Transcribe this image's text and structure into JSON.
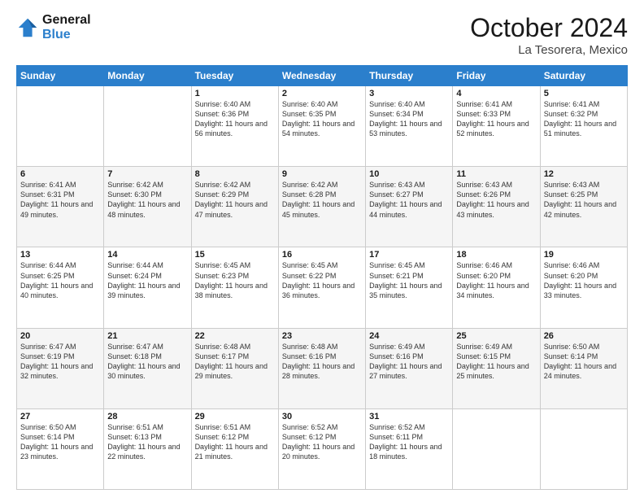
{
  "logo": {
    "line1": "General",
    "line2": "Blue"
  },
  "header": {
    "month": "October 2024",
    "location": "La Tesorera, Mexico"
  },
  "weekdays": [
    "Sunday",
    "Monday",
    "Tuesday",
    "Wednesday",
    "Thursday",
    "Friday",
    "Saturday"
  ],
  "weeks": [
    [
      {
        "day": "",
        "info": ""
      },
      {
        "day": "",
        "info": ""
      },
      {
        "day": "1",
        "info": "Sunrise: 6:40 AM\nSunset: 6:36 PM\nDaylight: 11 hours and 56 minutes."
      },
      {
        "day": "2",
        "info": "Sunrise: 6:40 AM\nSunset: 6:35 PM\nDaylight: 11 hours and 54 minutes."
      },
      {
        "day": "3",
        "info": "Sunrise: 6:40 AM\nSunset: 6:34 PM\nDaylight: 11 hours and 53 minutes."
      },
      {
        "day": "4",
        "info": "Sunrise: 6:41 AM\nSunset: 6:33 PM\nDaylight: 11 hours and 52 minutes."
      },
      {
        "day": "5",
        "info": "Sunrise: 6:41 AM\nSunset: 6:32 PM\nDaylight: 11 hours and 51 minutes."
      }
    ],
    [
      {
        "day": "6",
        "info": "Sunrise: 6:41 AM\nSunset: 6:31 PM\nDaylight: 11 hours and 49 minutes."
      },
      {
        "day": "7",
        "info": "Sunrise: 6:42 AM\nSunset: 6:30 PM\nDaylight: 11 hours and 48 minutes."
      },
      {
        "day": "8",
        "info": "Sunrise: 6:42 AM\nSunset: 6:29 PM\nDaylight: 11 hours and 47 minutes."
      },
      {
        "day": "9",
        "info": "Sunrise: 6:42 AM\nSunset: 6:28 PM\nDaylight: 11 hours and 45 minutes."
      },
      {
        "day": "10",
        "info": "Sunrise: 6:43 AM\nSunset: 6:27 PM\nDaylight: 11 hours and 44 minutes."
      },
      {
        "day": "11",
        "info": "Sunrise: 6:43 AM\nSunset: 6:26 PM\nDaylight: 11 hours and 43 minutes."
      },
      {
        "day": "12",
        "info": "Sunrise: 6:43 AM\nSunset: 6:25 PM\nDaylight: 11 hours and 42 minutes."
      }
    ],
    [
      {
        "day": "13",
        "info": "Sunrise: 6:44 AM\nSunset: 6:25 PM\nDaylight: 11 hours and 40 minutes."
      },
      {
        "day": "14",
        "info": "Sunrise: 6:44 AM\nSunset: 6:24 PM\nDaylight: 11 hours and 39 minutes."
      },
      {
        "day": "15",
        "info": "Sunrise: 6:45 AM\nSunset: 6:23 PM\nDaylight: 11 hours and 38 minutes."
      },
      {
        "day": "16",
        "info": "Sunrise: 6:45 AM\nSunset: 6:22 PM\nDaylight: 11 hours and 36 minutes."
      },
      {
        "day": "17",
        "info": "Sunrise: 6:45 AM\nSunset: 6:21 PM\nDaylight: 11 hours and 35 minutes."
      },
      {
        "day": "18",
        "info": "Sunrise: 6:46 AM\nSunset: 6:20 PM\nDaylight: 11 hours and 34 minutes."
      },
      {
        "day": "19",
        "info": "Sunrise: 6:46 AM\nSunset: 6:20 PM\nDaylight: 11 hours and 33 minutes."
      }
    ],
    [
      {
        "day": "20",
        "info": "Sunrise: 6:47 AM\nSunset: 6:19 PM\nDaylight: 11 hours and 32 minutes."
      },
      {
        "day": "21",
        "info": "Sunrise: 6:47 AM\nSunset: 6:18 PM\nDaylight: 11 hours and 30 minutes."
      },
      {
        "day": "22",
        "info": "Sunrise: 6:48 AM\nSunset: 6:17 PM\nDaylight: 11 hours and 29 minutes."
      },
      {
        "day": "23",
        "info": "Sunrise: 6:48 AM\nSunset: 6:16 PM\nDaylight: 11 hours and 28 minutes."
      },
      {
        "day": "24",
        "info": "Sunrise: 6:49 AM\nSunset: 6:16 PM\nDaylight: 11 hours and 27 minutes."
      },
      {
        "day": "25",
        "info": "Sunrise: 6:49 AM\nSunset: 6:15 PM\nDaylight: 11 hours and 25 minutes."
      },
      {
        "day": "26",
        "info": "Sunrise: 6:50 AM\nSunset: 6:14 PM\nDaylight: 11 hours and 24 minutes."
      }
    ],
    [
      {
        "day": "27",
        "info": "Sunrise: 6:50 AM\nSunset: 6:14 PM\nDaylight: 11 hours and 23 minutes."
      },
      {
        "day": "28",
        "info": "Sunrise: 6:51 AM\nSunset: 6:13 PM\nDaylight: 11 hours and 22 minutes."
      },
      {
        "day": "29",
        "info": "Sunrise: 6:51 AM\nSunset: 6:12 PM\nDaylight: 11 hours and 21 minutes."
      },
      {
        "day": "30",
        "info": "Sunrise: 6:52 AM\nSunset: 6:12 PM\nDaylight: 11 hours and 20 minutes."
      },
      {
        "day": "31",
        "info": "Sunrise: 6:52 AM\nSunset: 6:11 PM\nDaylight: 11 hours and 18 minutes."
      },
      {
        "day": "",
        "info": ""
      },
      {
        "day": "",
        "info": ""
      }
    ]
  ]
}
